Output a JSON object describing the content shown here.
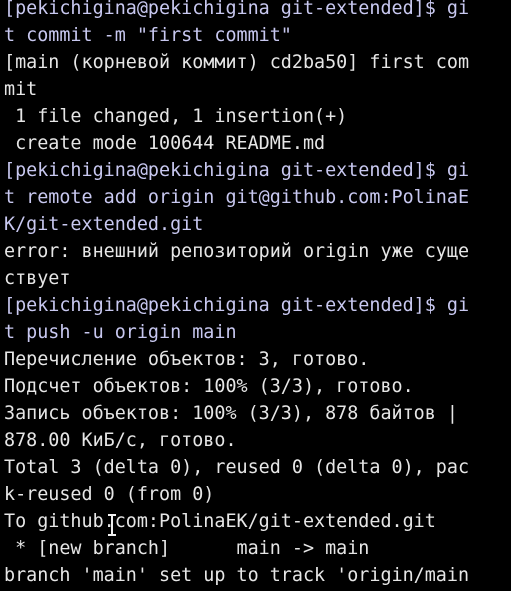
{
  "terminal": {
    "colors": {
      "background": "#000000",
      "text": "#e6e6e6",
      "prompt": "#c8c8f0"
    },
    "lines": [
      {
        "text": "[pekichigina@pekichigina git-extended]$ gi",
        "kind": "prompt"
      },
      {
        "text": "t commit -m \"first commit\"",
        "kind": "prompt"
      },
      {
        "text": "[main (корневой коммит) cd2ba50] first com",
        "kind": "output"
      },
      {
        "text": "mit",
        "kind": "output"
      },
      {
        "text": " 1 file changed, 1 insertion(+)",
        "kind": "output"
      },
      {
        "text": " create mode 100644 README.md",
        "kind": "output"
      },
      {
        "text": "[pekichigina@pekichigina git-extended]$ gi",
        "kind": "prompt"
      },
      {
        "text": "t remote add origin git@github.com:PolinaE",
        "kind": "prompt"
      },
      {
        "text": "K/git-extended.git",
        "kind": "prompt"
      },
      {
        "text": "error: внешний репозиторий origin уже суще",
        "kind": "output"
      },
      {
        "text": "ствует",
        "kind": "output"
      },
      {
        "text": "[pekichigina@pekichigina git-extended]$ gi",
        "kind": "prompt"
      },
      {
        "text": "t push -u origin main",
        "kind": "prompt"
      },
      {
        "text": "Перечисление объектов: 3, готово.",
        "kind": "output"
      },
      {
        "text": "Подсчет объектов: 100% (3/3), готово.",
        "kind": "output"
      },
      {
        "text": "Запись объектов: 100% (3/3), 878 байтов |",
        "kind": "output"
      },
      {
        "text": "878.00 КиБ/с, готово.",
        "kind": "output"
      },
      {
        "text": "Total 3 (delta 0), reused 0 (delta 0), pac",
        "kind": "output"
      },
      {
        "text": "k-reused 0 (from 0)",
        "kind": "output"
      },
      {
        "text": "To github.com:PolinaEK/git-extended.git",
        "kind": "output"
      },
      {
        "text": " * [new branch]      main -> main",
        "kind": "output"
      },
      {
        "text": "branch 'main' set up to track 'origin/main",
        "kind": "output"
      }
    ],
    "mouse_cursor_icon": "ibeam-cursor-icon"
  }
}
